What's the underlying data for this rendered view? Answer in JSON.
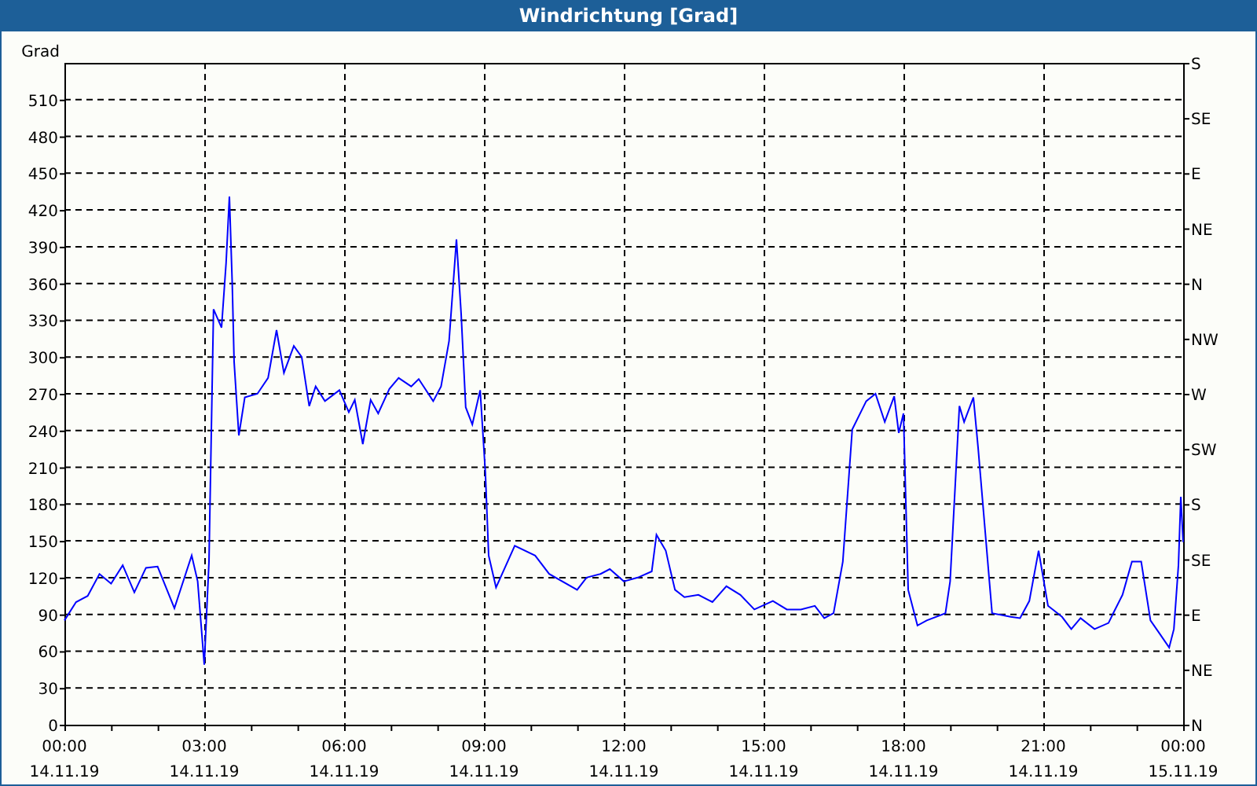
{
  "window": {
    "title": "Windrichtung [Grad]"
  },
  "chart": {
    "x_dates": [
      "14.11.19",
      "14.11.19",
      "14.11.19",
      "14.11.19",
      "14.11.19",
      "14.11.19",
      "14.11.19",
      "14.11.19",
      "15.11.19"
    ],
    "right_axis": [
      "S",
      "SE",
      "E",
      "NE",
      "N",
      "NW",
      "W",
      "SW",
      "S",
      "SE",
      "E",
      "NE",
      "N"
    ],
    "chart_data": {
      "type": "line",
      "grid": true,
      "ylabel": "Grad",
      "xlim": [
        0,
        24
      ],
      "ylim": [
        0,
        540
      ],
      "xticks": [
        {
          "value": 0,
          "label": "00:00"
        },
        {
          "value": 3,
          "label": "03:00"
        },
        {
          "value": 6,
          "label": "06:00"
        },
        {
          "value": 9,
          "label": "09:00"
        },
        {
          "value": 12,
          "label": "12:00"
        },
        {
          "value": 15,
          "label": "15:00"
        },
        {
          "value": 18,
          "label": "18:00"
        },
        {
          "value": 21,
          "label": "21:00"
        },
        {
          "value": 24,
          "label": "00:00"
        }
      ],
      "yticks": [
        0,
        30,
        60,
        90,
        120,
        150,
        180,
        210,
        240,
        270,
        300,
        330,
        360,
        390,
        420,
        450,
        480,
        510
      ],
      "x": [
        0,
        0.25,
        0.5,
        0.75,
        1.0,
        1.25,
        1.5,
        1.75,
        2.0,
        2.36,
        2.73,
        2.86,
        3.0,
        3.1,
        3.2,
        3.37,
        3.47,
        3.54,
        3.6,
        3.64,
        3.74,
        3.87,
        4.14,
        4.37,
        4.55,
        4.71,
        4.92,
        5.09,
        5.25,
        5.39,
        5.59,
        5.9,
        6.1,
        6.23,
        6.4,
        6.57,
        6.73,
        6.97,
        7.17,
        7.44,
        7.6,
        7.91,
        8.08,
        8.25,
        8.41,
        8.51,
        8.61,
        8.75,
        8.92,
        9.03,
        9.1,
        9.26,
        9.66,
        10.1,
        10.4,
        11.0,
        11.2,
        11.5,
        11.7,
        12.0,
        12.3,
        12.6,
        12.7,
        12.9,
        13.1,
        13.3,
        13.6,
        13.9,
        14.2,
        14.5,
        14.8,
        15.2,
        15.5,
        15.8,
        16.1,
        16.3,
        16.5,
        16.7,
        16.9,
        17.2,
        17.4,
        17.6,
        17.8,
        17.9,
        18.0,
        18.1,
        18.3,
        18.5,
        18.9,
        19.0,
        19.2,
        19.3,
        19.5,
        19.6,
        19.9,
        20.3,
        20.5,
        20.7,
        20.9,
        21.1,
        21.4,
        21.6,
        21.8,
        22.1,
        22.4,
        22.5,
        22.7,
        22.9,
        23.1,
        23.3,
        23.5,
        23.7,
        23.8,
        23.9,
        23.95,
        24.0
      ],
      "series": [
        {
          "color": "#0000ff",
          "values": [
            85,
            100,
            105,
            123,
            115,
            130,
            108,
            128,
            129,
            95,
            138,
            117,
            49,
            133,
            339,
            324,
            377,
            431,
            360,
            296,
            236,
            267,
            270,
            283,
            322,
            287,
            309,
            300,
            260,
            276,
            264,
            273,
            255,
            265,
            229,
            265,
            254,
            274,
            283,
            276,
            282,
            264,
            276,
            313,
            396,
            335,
            259,
            245,
            273,
            206,
            138,
            112,
            146,
            138,
            123,
            110,
            120,
            123,
            127,
            117,
            120,
            125,
            155,
            142,
            110,
            104,
            106,
            100,
            113,
            106,
            94,
            101,
            94,
            94,
            97,
            87,
            91,
            133,
            241,
            264,
            270,
            247,
            268,
            238,
            254,
            110,
            81,
            85,
            91,
            117,
            260,
            247,
            267,
            226,
            91,
            88,
            87,
            101,
            142,
            97,
            88,
            78,
            87,
            78,
            83,
            91,
            106,
            133,
            133,
            85,
            74,
            63,
            78,
            130,
            186,
            149
          ]
        }
      ]
    }
  }
}
